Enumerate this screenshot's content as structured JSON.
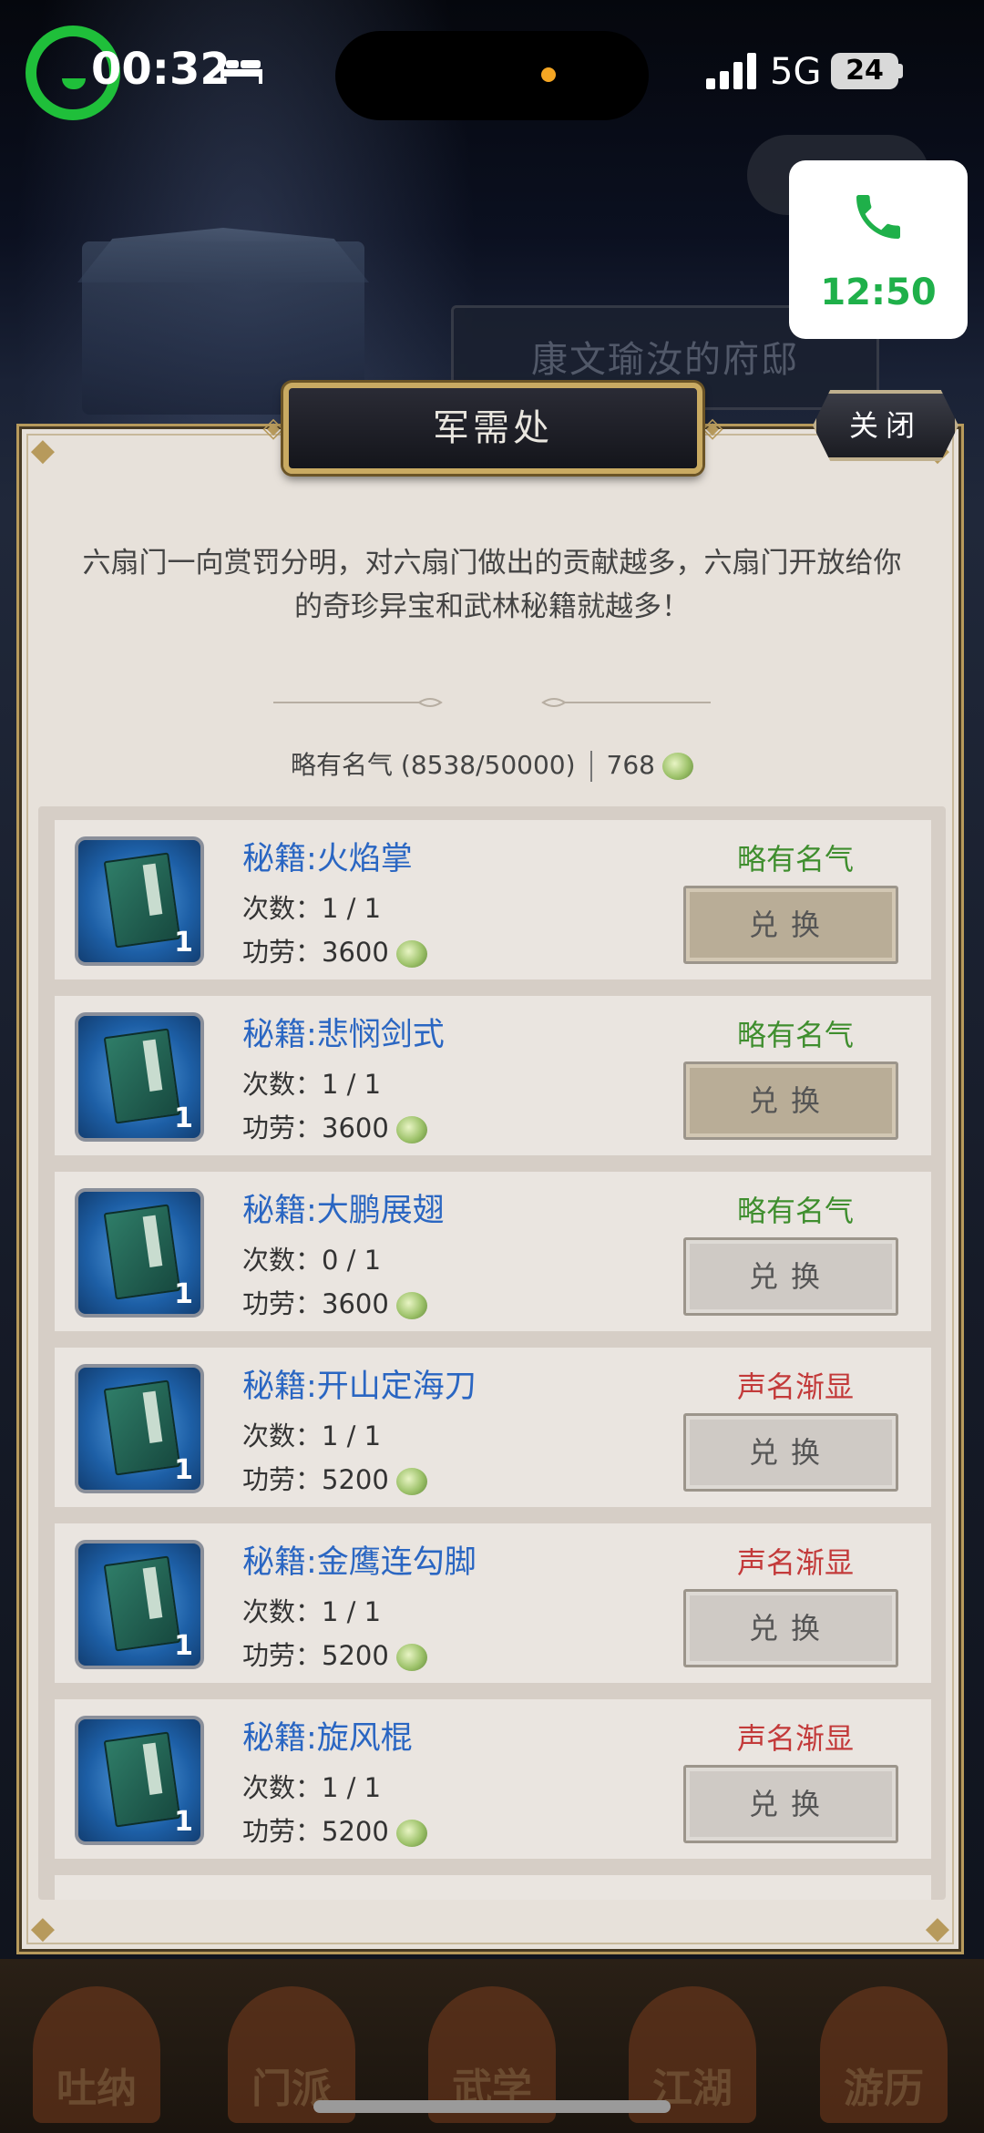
{
  "status_bar": {
    "time": "00:32",
    "network": "5G",
    "battery": "24"
  },
  "call_widget": {
    "duration": "12:50"
  },
  "background": {
    "mansion_name": "康文瑜汝的府邸",
    "nav_labels": [
      "吐纳",
      "门派",
      "武学",
      "江湖",
      "游历"
    ]
  },
  "dialog": {
    "title": "军需处",
    "close_label": "关闭",
    "intro": "六扇门一向赏罚分明，对六扇门做出的贡献越多，六扇门开放给你的奇珍异宝和武林秘籍就越多！",
    "fame_status": "略有名气 (8538/50000)",
    "merit_balance": "768",
    "count_prefix": "次数：",
    "cost_prefix": "功劳：",
    "exchange_label": "兑换"
  },
  "items": [
    {
      "name": "秘籍:火焰掌",
      "count": "1 / 1",
      "cost": "3600",
      "requirement": "略有名气",
      "req_color": "#3f8e2e",
      "qty": "1",
      "button_state": "active"
    },
    {
      "name": "秘籍:悲悯剑式",
      "count": "1 / 1",
      "cost": "3600",
      "requirement": "略有名气",
      "req_color": "#3f8e2e",
      "qty": "1",
      "button_state": "active"
    },
    {
      "name": "秘籍:大鹏展翅",
      "count": "0 / 1",
      "cost": "3600",
      "requirement": "略有名气",
      "req_color": "#3f8e2e",
      "qty": "1",
      "button_state": "disabled"
    },
    {
      "name": "秘籍:开山定海刀",
      "count": "1 / 1",
      "cost": "5200",
      "requirement": "声名渐显",
      "req_color": "#c33a3a",
      "qty": "1",
      "button_state": "disabled"
    },
    {
      "name": "秘籍:金鹰连勾脚",
      "count": "1 / 1",
      "cost": "5200",
      "requirement": "声名渐显",
      "req_color": "#c33a3a",
      "qty": "1",
      "button_state": "disabled"
    },
    {
      "name": "秘籍:旋风棍",
      "count": "1 / 1",
      "cost": "5200",
      "requirement": "声名渐显",
      "req_color": "#c33a3a",
      "qty": "1",
      "button_state": "disabled"
    }
  ],
  "icons": {
    "recording": "recording-indicator-icon",
    "sleep": "bed-icon",
    "signal": "signal-icon",
    "call": "phone-icon",
    "merit": "merit-coin-icon",
    "book": "skill-book-icon"
  }
}
